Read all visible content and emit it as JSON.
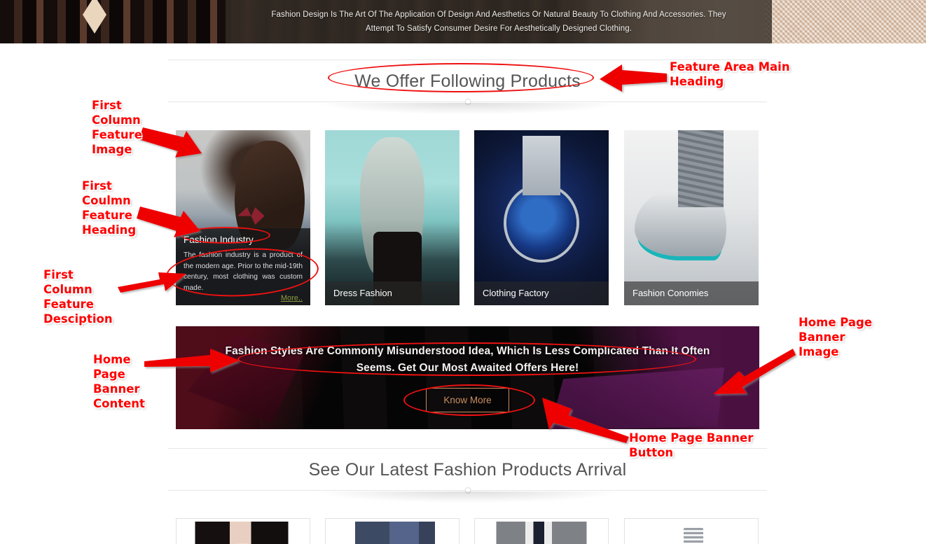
{
  "hero": {
    "text_line1": "Fashion Design Is The Art Of The Application Of Design And Aesthetics Or Natural Beauty To Clothing And Accessories. They",
    "text_line2": "Attempt To Satisfy Consumer Desire For Aesthetically Designed Clothing."
  },
  "features": {
    "heading": "We Offer Following Products",
    "cards": [
      {
        "title": "Fashion Industry",
        "description": "The fashion industry is a product of the modern age. Prior to the mid-19th century, most clothing was custom made.",
        "more_label": "More..",
        "image_alt": "man-in-suit-with-bow-tie"
      },
      {
        "title": "Dress Fashion",
        "image_alt": "woman-with-long-hair-teal"
      },
      {
        "title": "Clothing Factory",
        "image_alt": "blue-chronograph-watch"
      },
      {
        "title": "Fashion Conomies",
        "image_alt": "grey-sneakers-on-feet"
      }
    ]
  },
  "promo": {
    "text_line1": "Fashion Styles Are Commonly Misunderstood Idea, Which Is Less Complicated Than It Often",
    "text_line2": "Seems. Get Our Most Awaited Offers Here!",
    "button_label": "Know More",
    "button_color": "#c98f62",
    "image_alt": "shopping-bags-street"
  },
  "arrivals": {
    "heading": "See Our Latest Fashion Products Arrival",
    "products": [
      {
        "image_alt": "woman-in-black-pinstripe-blazer"
      },
      {
        "image_alt": "navy-blue-dress-shirt"
      },
      {
        "image_alt": "man-in-grey-suit-with-tie"
      },
      {
        "image_alt": "stack-of-folded-items"
      }
    ]
  },
  "annotations": {
    "color": "#ff0000",
    "items": [
      {
        "id": "feature-area-main-heading",
        "text": "Feature Area Main\nHeading"
      },
      {
        "id": "first-column-feature-image",
        "text": "First\nColumn\nFeature\nImage"
      },
      {
        "id": "first-column-feature-heading",
        "text": "First\nCoulmn\nFeature\nHeading"
      },
      {
        "id": "first-column-feature-description",
        "text": "First\nColumn\nFeature\nDesciption"
      },
      {
        "id": "home-page-banner-content",
        "text": "Home\nPage\nBanner\nContent"
      },
      {
        "id": "home-page-banner-image",
        "text": "Home Page\nBanner\nImage"
      },
      {
        "id": "home-page-banner-button",
        "text": "Home Page Banner\nButton"
      }
    ]
  }
}
